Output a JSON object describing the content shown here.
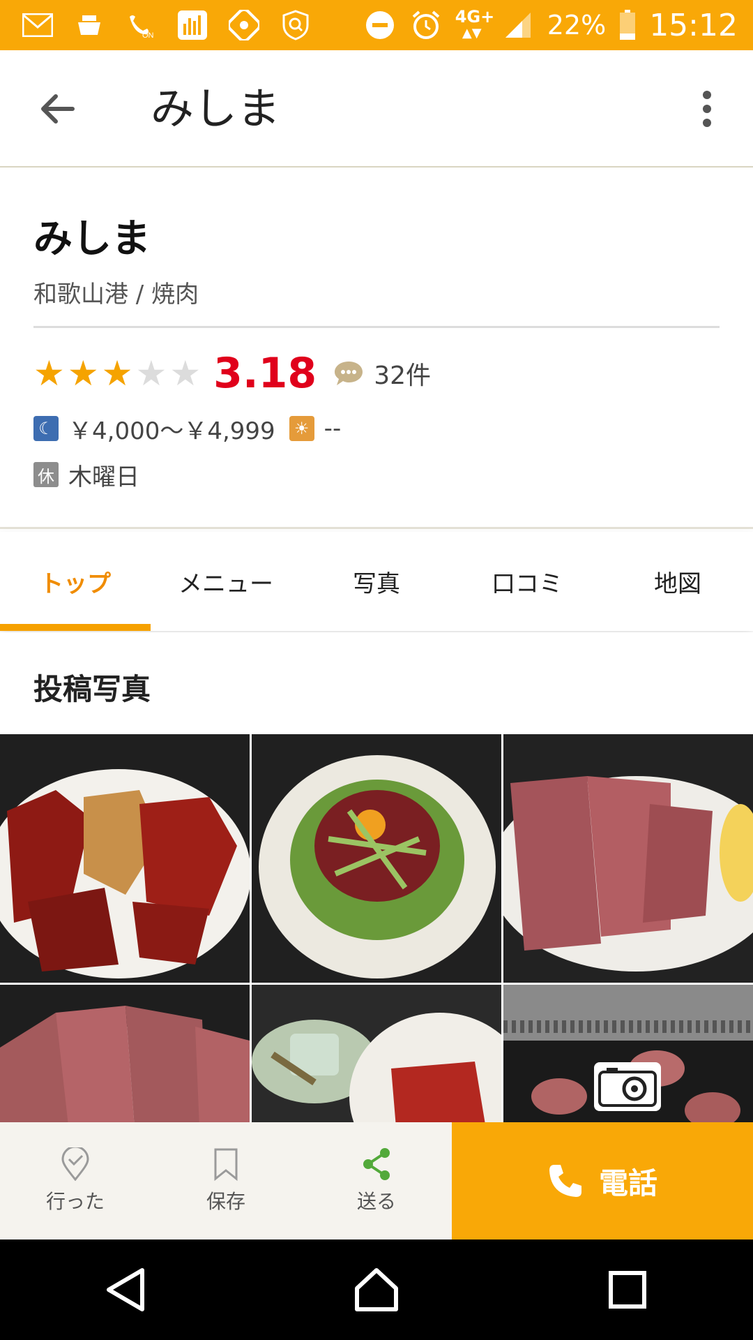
{
  "status_bar": {
    "network": "4G+",
    "battery": "22%",
    "time": "15:12",
    "on_label": "ON",
    "accent_color": "#f9a807"
  },
  "app_bar": {
    "title": "みしま",
    "back_icon": "arrow-left-icon",
    "menu_icon": "more-vert-icon"
  },
  "shop": {
    "name": "みしま",
    "area_genre": "和歌山港 / 焼肉",
    "stars": 3.18,
    "rating": "3.18",
    "review_count": "32件",
    "dinner_price": "￥4,000～￥4,999",
    "lunch_price": "--",
    "holiday_badge": "休",
    "holiday": "木曜日"
  },
  "tabs": [
    {
      "label": "トップ",
      "active": true
    },
    {
      "label": "メニュー",
      "active": false
    },
    {
      "label": "写真",
      "active": false
    },
    {
      "label": "口コミ",
      "active": false
    },
    {
      "label": "地図",
      "active": false
    }
  ],
  "photos": {
    "title": "投稿写真",
    "items": [
      "grilled-meat-plate",
      "meat-salad-with-egg",
      "beef-tongue-with-lemon",
      "sliced-tongue-plate",
      "side-dishes-and-meat",
      "grill-with-tongue"
    ]
  },
  "actions": {
    "went": "行った",
    "save": "保存",
    "share": "送る",
    "call": "電話"
  }
}
